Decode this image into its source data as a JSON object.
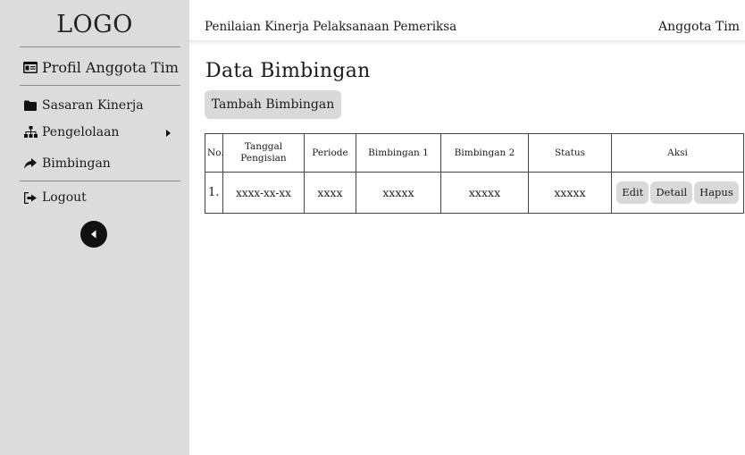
{
  "sidebar": {
    "logo": "LOGO",
    "profile": {
      "label": "Profil Anggota Tim",
      "icon": "id-card-icon"
    },
    "items": [
      {
        "label": "Sasaran Kinerja",
        "icon": "folder-icon"
      },
      {
        "label": "Pengelolaan",
        "icon": "sitemap-icon",
        "has_submenu": true
      },
      {
        "label": "Bimbingan",
        "icon": "share-arrow-icon"
      }
    ],
    "logout": {
      "label": "Logout",
      "icon": "logout-icon"
    },
    "collapse_icon": "chevron-left-circle-icon"
  },
  "header": {
    "title": "Penilaian Kinerja Pelaksanaan Pemeriksa",
    "user_role": "Anggota Tim"
  },
  "main": {
    "title": "Data Bimbingan",
    "add_button": "Tambah Bimbingan",
    "table": {
      "headers": [
        "No.",
        "Tanggal Pengisian",
        "Periode",
        "Bimbingan 1",
        "Bimbingan 2",
        "Status",
        "Aksi"
      ],
      "rows": [
        {
          "no": "1.",
          "tanggal": "xxxx-xx-xx",
          "periode": "xxxx",
          "bimbingan1": "xxxxx",
          "bimbingan2": "xxxxx",
          "status": "xxxxx",
          "actions": [
            "Edit",
            "Detail",
            "Hapus"
          ]
        }
      ]
    }
  },
  "colors": {
    "sidebar_bg": "#dcdcdc",
    "button_bg": "#d9d9d9",
    "text": "#1a1a1a"
  }
}
